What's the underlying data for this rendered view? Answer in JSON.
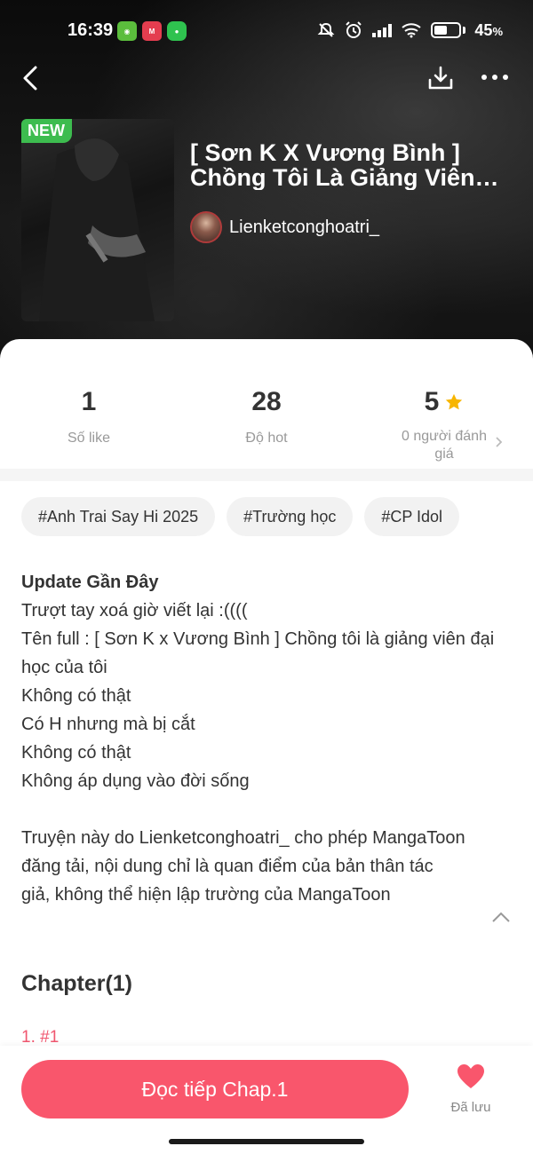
{
  "status_bar": {
    "time": "16:39",
    "battery": "45",
    "battery_unit": "%",
    "app_icons": [
      "duolingo-app-icon",
      "mangatoon-app-icon",
      "messages-app-icon"
    ]
  },
  "header": {
    "badge": "NEW",
    "title": "[ Sơn K X Vương Bình ] Chồng Tôi Là Giảng Viên Đại Học Của Tôi",
    "author": "Lienketconghoatri_"
  },
  "stats": {
    "likes_value": "1",
    "likes_label": "Số like",
    "hot_value": "28",
    "hot_label": "Độ hot",
    "rating_value": "5",
    "rating_label": "0 người đánh giá"
  },
  "tags": [
    "#Anh Trai Say Hi 2025",
    "#Trường học",
    "#CP Idol"
  ],
  "description": {
    "heading": "Update Gần Đây",
    "lines": [
      "Trượt tay xoá giờ viết lại :((((",
      "Tên full : [ Sơn K x Vương Bình ] Chồng tôi là giảng viên đại học của tôi",
      "Không có thật",
      "Có H nhưng mà bị cắt",
      "Không có thật",
      "Không áp dụng vào đời sống"
    ],
    "disclaimer": "Truyện này do Lienketconghoatri_ cho phép MangaToon đăng tải, nội dung chỉ là quan điểm của bản thân tác giả, không thể hiện lập trường của MangaToon"
  },
  "chapters": {
    "title": "Chapter(1)",
    "items": [
      "1. #1"
    ]
  },
  "bottom_bar": {
    "read_label": "Đọc tiếp Chap.1",
    "saved_label": "Đã lưu"
  },
  "colors": {
    "accent": "#f9566c",
    "badge_green": "#3dbc4f",
    "star": "#f7b500"
  }
}
